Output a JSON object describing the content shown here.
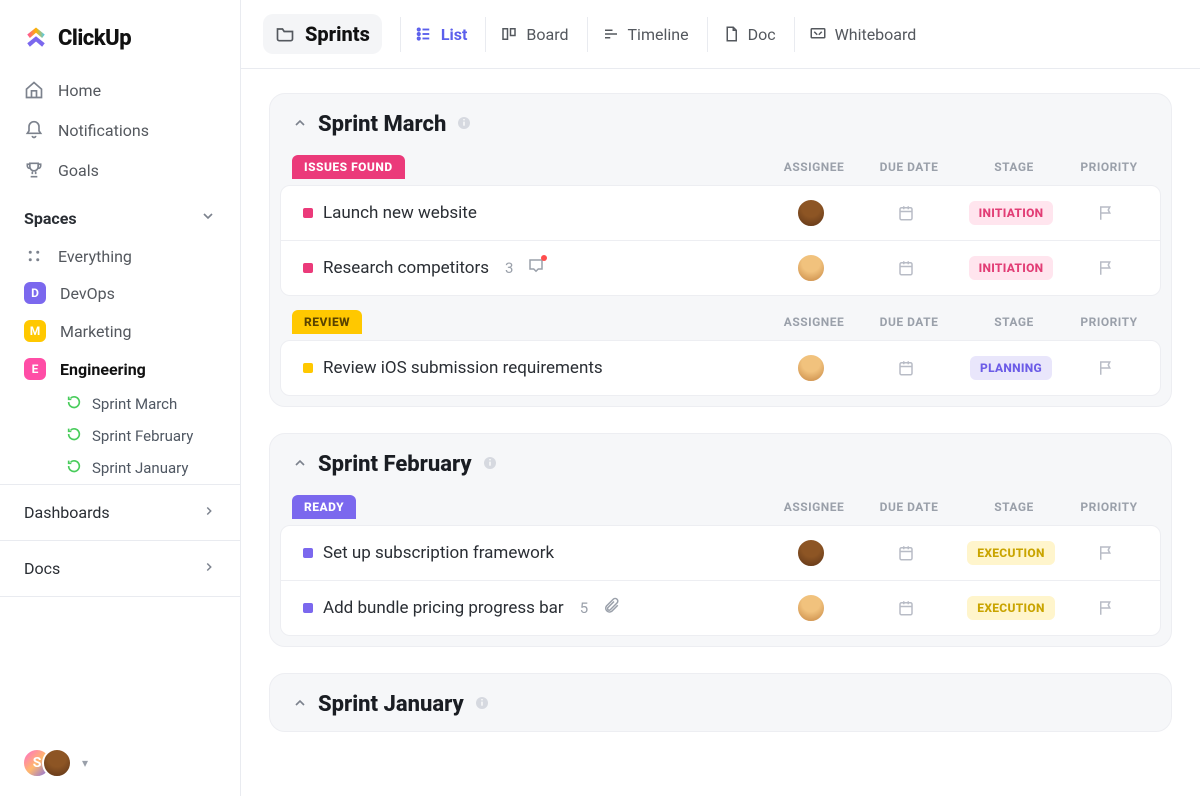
{
  "brand": "ClickUp",
  "nav": {
    "home": "Home",
    "notifications": "Notifications",
    "goals": "Goals"
  },
  "spaces": {
    "header": "Spaces",
    "everything": "Everything",
    "items": [
      {
        "letter": "D",
        "label": "DevOps"
      },
      {
        "letter": "M",
        "label": "Marketing"
      },
      {
        "letter": "E",
        "label": "Engineering"
      }
    ],
    "engineering_children": [
      "Sprint  March",
      "Sprint  February",
      "Sprint January"
    ]
  },
  "sections": {
    "dashboards": "Dashboards",
    "docs": "Docs"
  },
  "user_letter": "S",
  "topbar": {
    "folder": "Sprints",
    "views": {
      "list": "List",
      "board": "Board",
      "timeline": "Timeline",
      "doc": "Doc",
      "whiteboard": "Whiteboard"
    }
  },
  "columns": {
    "assignee": "ASSIGNEE",
    "due": "DUE DATE",
    "stage": "STAGE",
    "priority": "PRIORITY"
  },
  "sprints": [
    {
      "title": "Sprint March",
      "groups": [
        {
          "status": "ISSUES FOUND",
          "status_class": "pink-bg",
          "sq_class": "sq-pink",
          "tasks": [
            {
              "title": "Launch new website",
              "stage": "INITIATION",
              "stage_class": "tag-initiation"
            },
            {
              "title": "Research competitors",
              "count": "3",
              "comment_icon": true,
              "stage": "INITIATION",
              "stage_class": "tag-initiation"
            }
          ]
        },
        {
          "status": "REVIEW",
          "status_class": "amber-bg",
          "sq_class": "sq-amber",
          "tasks": [
            {
              "title": "Review iOS submission requirements",
              "stage": "PLANNING",
              "stage_class": "tag-planning"
            }
          ]
        }
      ]
    },
    {
      "title": "Sprint February",
      "groups": [
        {
          "status": "READY",
          "status_class": "violet-bg",
          "sq_class": "sq-violet",
          "tasks": [
            {
              "title": "Set up subscription framework",
              "stage": "EXECUTION",
              "stage_class": "tag-execution"
            },
            {
              "title": "Add bundle pricing progress bar",
              "count": "5",
              "attach_icon": true,
              "stage": "EXECUTION",
              "stage_class": "tag-execution"
            }
          ]
        }
      ]
    },
    {
      "title": "Sprint January",
      "collapsed": true
    }
  ]
}
